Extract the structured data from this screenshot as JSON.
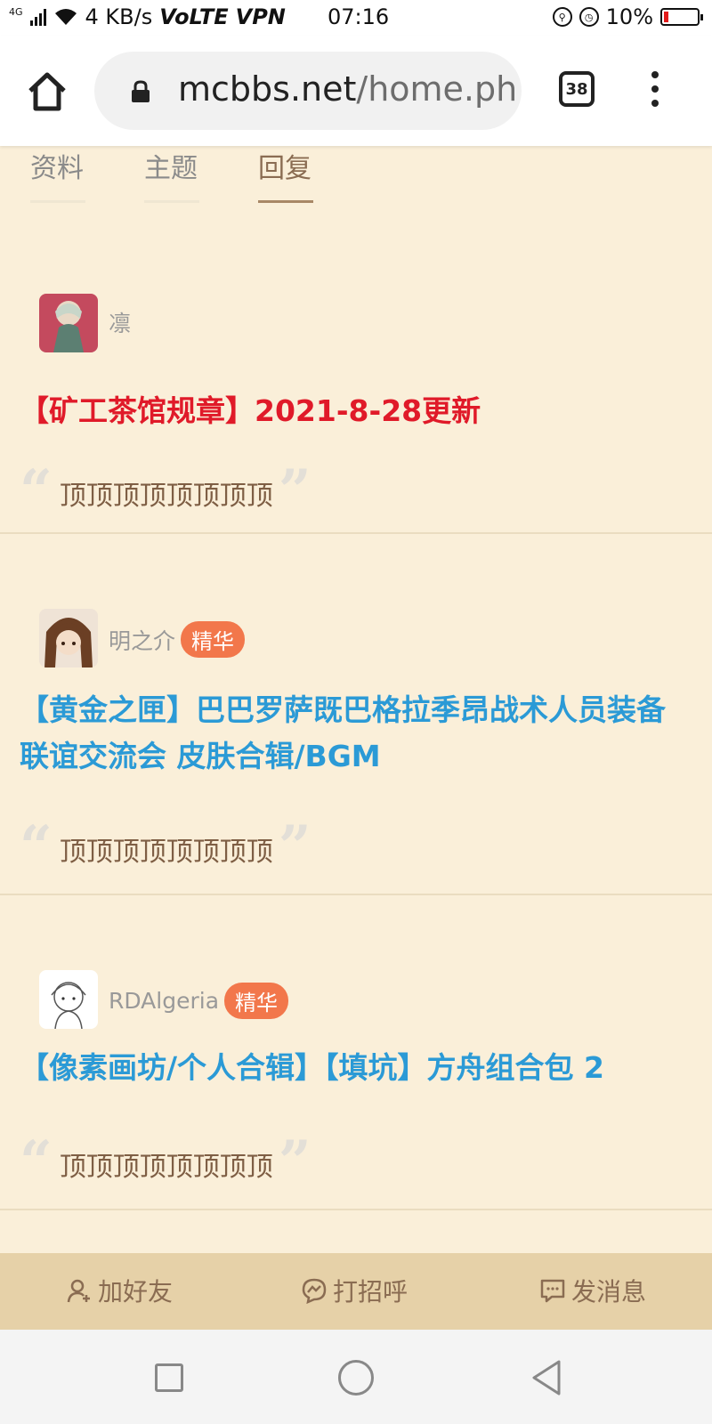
{
  "status_bar": {
    "signal_label": "4G",
    "speed": "4 KB/s",
    "volte": "VoLTE",
    "vpn": "VPN",
    "time": "07:16",
    "battery": "10%",
    "battery_level": 0.1
  },
  "browser": {
    "url_host": "mcbbs.net",
    "url_path": "/home.ph",
    "tab_count": "38"
  },
  "nav_tabs": [
    {
      "label": "资料",
      "active": false
    },
    {
      "label": "主题",
      "active": false
    },
    {
      "label": "回复",
      "active": true
    }
  ],
  "posts": [
    {
      "author": "凛",
      "badge": "",
      "title": "【矿工茶馆规章】2021-8-28更新",
      "reply": "顶顶顶顶顶顶顶顶"
    },
    {
      "author": "明之介",
      "badge": "精华",
      "title": "【黄金之匣】巴巴罗萨既巴格拉季昂战术人员装备联谊交流会 皮肤合辑/BGM",
      "reply": "顶顶顶顶顶顶顶顶"
    },
    {
      "author": "RDAlgeria",
      "badge": "精华",
      "title": "【像素画坊/个人合辑】【填坑】方舟组合包 2",
      "reply": "顶顶顶顶顶顶顶顶"
    }
  ],
  "actions": {
    "add_friend": "加好友",
    "greet": "打招呼",
    "message": "发消息"
  },
  "colors": {
    "page_bg": "#faefd9",
    "title_red": "#e01a29",
    "title_blue": "#2b9ad6",
    "badge": "#f2774b",
    "action_bar": "#e6d1a8",
    "action_text": "#8a6c52"
  }
}
